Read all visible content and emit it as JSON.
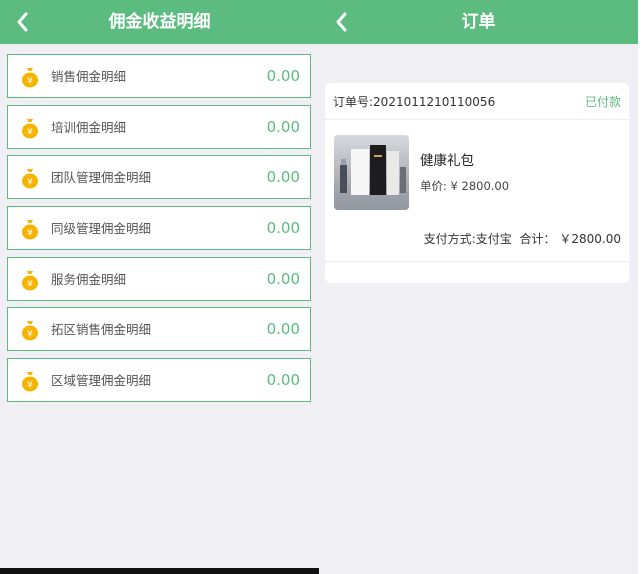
{
  "left": {
    "title": "佣金收益明细",
    "items": [
      {
        "label": "销售佣金明细",
        "amount": "0.00"
      },
      {
        "label": "培训佣金明细",
        "amount": "0.00"
      },
      {
        "label": "团队管理佣金明细",
        "amount": "0.00"
      },
      {
        "label": "同级管理佣金明细",
        "amount": "0.00"
      },
      {
        "label": "服务佣金明细",
        "amount": "0.00"
      },
      {
        "label": "拓区销售佣金明细",
        "amount": "0.00"
      },
      {
        "label": "区域管理佣金明细",
        "amount": "0.00"
      }
    ],
    "icons": {
      "back": "chevron-left-icon",
      "coin": "money-bag-icon"
    }
  },
  "right": {
    "title": "订单",
    "order": {
      "number_label": "订单号:2021011210110056",
      "status": "已付款",
      "product_name": "健康礼包",
      "unit_price": "单价: ¥ 2800.00",
      "payment_method": "支付方式:支付宝",
      "total": "合计： ￥2800.00"
    }
  },
  "colors": {
    "accent": "#5cbb7f",
    "background": "#efeff4",
    "coin": "#f4b400"
  }
}
